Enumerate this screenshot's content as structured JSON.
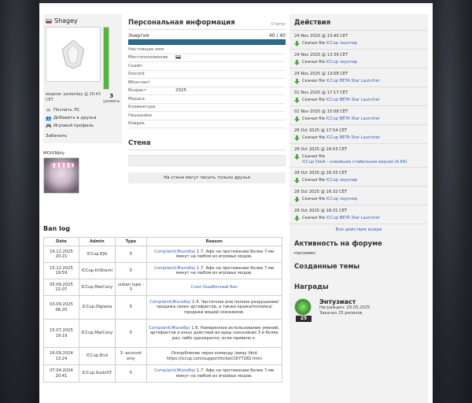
{
  "profile": {
    "name": "Shagey",
    "seen": "видели: yesterday @ 20:43 CET",
    "level": "3",
    "level_label": "уровень",
    "energy_fraction": 1.0,
    "links": [
      {
        "label": "Послать ЛС",
        "icon": "mail-icon"
      },
      {
        "label": "Добавить в друзья",
        "icon": "add-friend-icon"
      },
      {
        "label": "Игровой профиль",
        "icon": "game-profile-icon"
      }
    ],
    "ban_label": "Забанить"
  },
  "friend": {
    "name": "MOIXNbIy"
  },
  "info": {
    "title": "Персональная информация",
    "status_label": "Статус",
    "energy_label": "Энергия",
    "energy_value": "40 / 40",
    "rows": [
      {
        "key": "Настоящее имя",
        "value": ""
      },
      {
        "key": "Местоположение",
        "value": ""
      },
      {
        "key": "Скайп",
        "value": ""
      },
      {
        "key": "Discord",
        "value": ""
      },
      {
        "key": "ВКонтакт",
        "value": ""
      },
      {
        "key": "Возраст",
        "value": "2025"
      },
      {
        "key": "Мышка",
        "value": ""
      },
      {
        "key": "Клавиатура",
        "value": ""
      },
      {
        "key": "Наушники",
        "value": ""
      },
      {
        "key": "Коврик",
        "value": ""
      }
    ]
  },
  "wall": {
    "title": "Стена",
    "message": "На стене могут писать только друзья"
  },
  "banlog": {
    "title": "Ban log",
    "headers": [
      "Date",
      "Admin",
      "Type",
      "Reason"
    ],
    "rows": [
      {
        "date": "19.12.2025 20:21",
        "admin": "ICCup.Ejik",
        "type": "5",
        "link": "Complaint(Жалоба)",
        "reason": " 1.7. Афк на протяжении более 7-ми минут на любом из игровых модов."
      },
      {
        "date": "15.12.2025 19:59",
        "admin": "ICCup.khShami",
        "type": "5",
        "link": "Complaint(Жалоба)",
        "reason": " 1.7. Афк на протяжении более 7-ми минут на любом из игровых модов."
      },
      {
        "date": "05.09.2025 22:07",
        "admin": "ICCup.MarCony",
        "type": "unban type - 3",
        "link": "Снял Ошибочный бан",
        "reason": ""
      },
      {
        "date": "03.09.2025 06:20",
        "admin": "ICCup.Olgiasia",
        "type": "5",
        "link": "Complaint(Жалоба)",
        "reason": " 1.4. Частичное или полное разрушение/продажа своих артефактов, а также кража/поломка/продажа вещей союзников."
      },
      {
        "date": "15.07.2025 19:19",
        "admin": "ICCup.MarCony",
        "type": "5",
        "link": "Complaint(Жалоба)",
        "reason": " 1.6. Намеренное использование умений, артефактов и иных действий во вред союзникам 3 и более раз, либо однократно, если привело к."
      },
      {
        "date": "16.09.2024 13:24",
        "admin": "ICCup.End",
        "type": "3- account only",
        "link": "",
        "reason": "Оскорбление через команду /away /dnd https://iccup.com/support/ticket/1677282.html"
      },
      {
        "date": "07.04.2024 20:41",
        "admin": "ICCup.SushiST",
        "type": "5",
        "link": "Complaint(Жалоба)",
        "reason": " 1.7. Афк на протяжении более 7-ми минут на любом из игровых модов."
      }
    ]
  },
  "actions": {
    "title": "Действия",
    "items": [
      {
        "date": "24 Nov 2025 @ 13:40 CET",
        "prefix": "Скачал file",
        "file": "ICCup лаунчер"
      },
      {
        "date": "24 Nov 2025 @ 13:39 CET",
        "prefix": "Скачал file",
        "file": "ICCup лаунчер"
      },
      {
        "date": "24 Nov 2025 @ 13:08 CET",
        "prefix": "Скачал file",
        "file": "ICCup BETA Star Launcher"
      },
      {
        "date": "01 Nov 2025 @ 17:17 CET",
        "prefix": "Скачал file",
        "file": "ICCup BETA Star Launcher"
      },
      {
        "date": "01 Nov 2025 @ 15:08 CET",
        "prefix": "Скачал file",
        "file": "ICCup BETA Star Launcher"
      },
      {
        "date": "28 Oct 2025 @ 17:54 CET",
        "prefix": "Скачал file",
        "file": "ICCup BETA Star Launcher"
      },
      {
        "date": "28 Oct 2025 @ 16:53 CET",
        "prefix": "Скачал file",
        "file": "ICCup DotA - новейшая стабильная версия (6.84)"
      },
      {
        "date": "28 Oct 2025 @ 16:33 CET",
        "prefix": "Скачал file",
        "file": "ICCup лаунчер"
      },
      {
        "date": "28 Oct 2025 @ 16:32 CET",
        "prefix": "Скачал file",
        "file": "ICCup лаунчер"
      },
      {
        "date": "28 Oct 2025 @ 16:31 CET",
        "prefix": "Скачал file",
        "file": "ICCup BETA Star Launcher"
      }
    ],
    "all_label": "Все действия юзера"
  },
  "forum": {
    "title": "Активность на форуме",
    "text": "пассивен"
  },
  "topics": {
    "title": "Созданные темы"
  },
  "awards": {
    "title": "Награды",
    "name": "Энтузиаст",
    "number": "25",
    "line1": "Награжден: 29.05.2025",
    "line2": "Закачал 25 релизов"
  },
  "colors": {
    "link": "#2f63b8",
    "energy": "#2d6a8e",
    "download": "#4aa93a"
  }
}
